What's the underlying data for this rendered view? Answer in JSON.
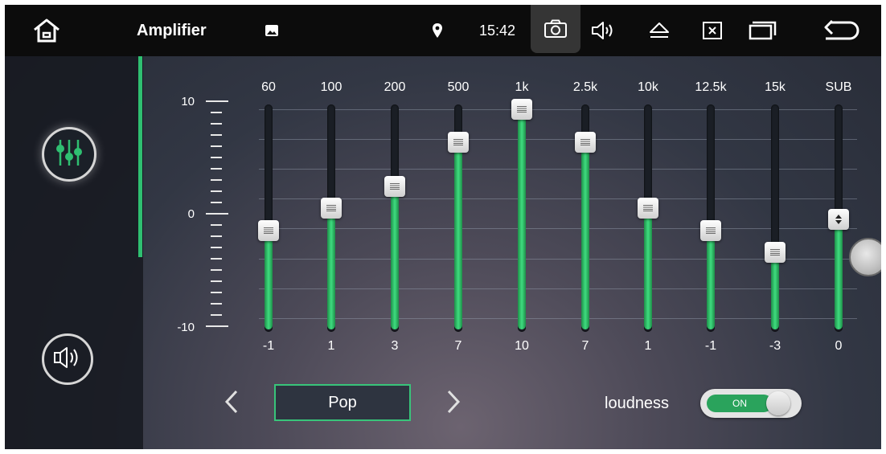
{
  "statusbar": {
    "app_title": "Amplifier",
    "clock": "15:42",
    "icons": [
      "home-icon",
      "image-icon",
      "location-pin-icon",
      "camera-icon",
      "volume-icon",
      "eject-icon",
      "close-box-icon",
      "recent-apps-icon",
      "back-icon"
    ]
  },
  "sidebar": {
    "items": [
      {
        "icon": "equalizer-icon",
        "active": true
      },
      {
        "icon": "speaker-icon",
        "active": false
      }
    ]
  },
  "equalizer": {
    "scale_labels": {
      "top": "10",
      "mid": "0",
      "bottom": "-10"
    },
    "scale_range": [
      -10,
      10
    ],
    "bands": [
      {
        "freq": "60",
        "gain": "-1",
        "value": -1
      },
      {
        "freq": "100",
        "gain": "1",
        "value": 1
      },
      {
        "freq": "200",
        "gain": "3",
        "value": 3
      },
      {
        "freq": "500",
        "gain": "7",
        "value": 7
      },
      {
        "freq": "1k",
        "gain": "10",
        "value": 10
      },
      {
        "freq": "2.5k",
        "gain": "7",
        "value": 7
      },
      {
        "freq": "10k",
        "gain": "1",
        "value": 1
      },
      {
        "freq": "12.5k",
        "gain": "-1",
        "value": -1
      },
      {
        "freq": "15k",
        "gain": "-3",
        "value": -3
      },
      {
        "freq": "SUB",
        "gain": "0",
        "value": 0
      }
    ]
  },
  "preset": {
    "label": "Pop",
    "prev_icon": "chevron-left-icon",
    "next_icon": "chevron-right-icon"
  },
  "loudness": {
    "label": "loudness",
    "state": "ON",
    "enabled": true
  },
  "colors": {
    "accent": "#2fbf71",
    "topbar": "#0c0c0c",
    "slider_fill": "#3fdc7f"
  }
}
